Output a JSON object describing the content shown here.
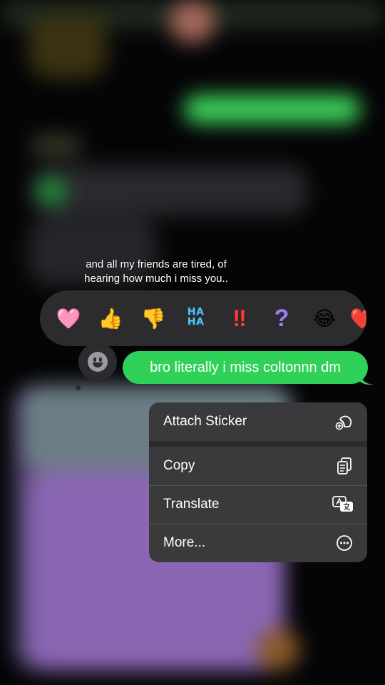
{
  "caption": {
    "line1": "and all my friends are tired, of",
    "line2": "hearing how much i miss you.."
  },
  "reactions": [
    {
      "name": "heart",
      "glyph": "🩷"
    },
    {
      "name": "thumbs-up",
      "glyph": "👍"
    },
    {
      "name": "thumbs-down",
      "glyph": "👎"
    },
    {
      "name": "haha",
      "glyph": "HA HA"
    },
    {
      "name": "exclamation",
      "glyph": "‼"
    },
    {
      "name": "question",
      "glyph": "?"
    },
    {
      "name": "laughing",
      "glyph": "😂"
    },
    {
      "name": "heart-partial",
      "glyph": "❤️"
    }
  ],
  "haha": {
    "top": "HA",
    "bottom": "HA"
  },
  "message": {
    "text": "bro literally i miss coltonnn dm",
    "bubble_color": "#30d158"
  },
  "menu": {
    "items": [
      {
        "label": "Attach Sticker",
        "icon": "sticker-icon"
      },
      {
        "label": "Copy",
        "icon": "copy-icon"
      },
      {
        "label": "Translate",
        "icon": "translate-icon"
      },
      {
        "label": "More...",
        "icon": "more-icon"
      }
    ]
  }
}
